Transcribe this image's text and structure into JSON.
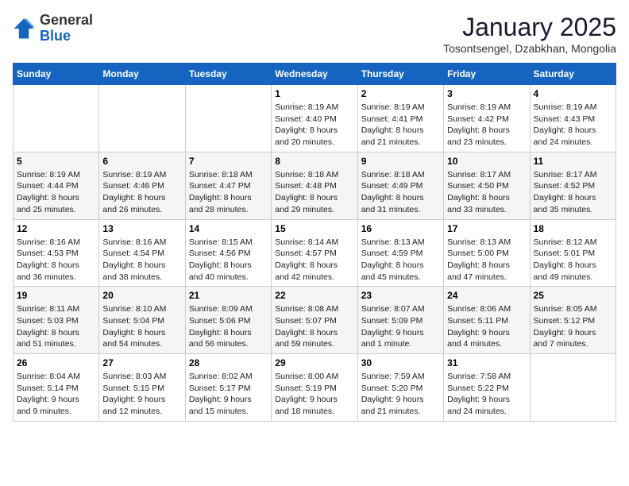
{
  "logo": {
    "general": "General",
    "blue": "Blue"
  },
  "title": "January 2025",
  "subtitle": "Tosontsengel, Dzabkhan, Mongolia",
  "days_of_week": [
    "Sunday",
    "Monday",
    "Tuesday",
    "Wednesday",
    "Thursday",
    "Friday",
    "Saturday"
  ],
  "weeks": [
    [
      {
        "day": "",
        "info": ""
      },
      {
        "day": "",
        "info": ""
      },
      {
        "day": "",
        "info": ""
      },
      {
        "day": "1",
        "info": "Sunrise: 8:19 AM\nSunset: 4:40 PM\nDaylight: 8 hours\nand 20 minutes."
      },
      {
        "day": "2",
        "info": "Sunrise: 8:19 AM\nSunset: 4:41 PM\nDaylight: 8 hours\nand 21 minutes."
      },
      {
        "day": "3",
        "info": "Sunrise: 8:19 AM\nSunset: 4:42 PM\nDaylight: 8 hours\nand 23 minutes."
      },
      {
        "day": "4",
        "info": "Sunrise: 8:19 AM\nSunset: 4:43 PM\nDaylight: 8 hours\nand 24 minutes."
      }
    ],
    [
      {
        "day": "5",
        "info": "Sunrise: 8:19 AM\nSunset: 4:44 PM\nDaylight: 8 hours\nand 25 minutes."
      },
      {
        "day": "6",
        "info": "Sunrise: 8:19 AM\nSunset: 4:46 PM\nDaylight: 8 hours\nand 26 minutes."
      },
      {
        "day": "7",
        "info": "Sunrise: 8:18 AM\nSunset: 4:47 PM\nDaylight: 8 hours\nand 28 minutes."
      },
      {
        "day": "8",
        "info": "Sunrise: 8:18 AM\nSunset: 4:48 PM\nDaylight: 8 hours\nand 29 minutes."
      },
      {
        "day": "9",
        "info": "Sunrise: 8:18 AM\nSunset: 4:49 PM\nDaylight: 8 hours\nand 31 minutes."
      },
      {
        "day": "10",
        "info": "Sunrise: 8:17 AM\nSunset: 4:50 PM\nDaylight: 8 hours\nand 33 minutes."
      },
      {
        "day": "11",
        "info": "Sunrise: 8:17 AM\nSunset: 4:52 PM\nDaylight: 8 hours\nand 35 minutes."
      }
    ],
    [
      {
        "day": "12",
        "info": "Sunrise: 8:16 AM\nSunset: 4:53 PM\nDaylight: 8 hours\nand 36 minutes."
      },
      {
        "day": "13",
        "info": "Sunrise: 8:16 AM\nSunset: 4:54 PM\nDaylight: 8 hours\nand 38 minutes."
      },
      {
        "day": "14",
        "info": "Sunrise: 8:15 AM\nSunset: 4:56 PM\nDaylight: 8 hours\nand 40 minutes."
      },
      {
        "day": "15",
        "info": "Sunrise: 8:14 AM\nSunset: 4:57 PM\nDaylight: 8 hours\nand 42 minutes."
      },
      {
        "day": "16",
        "info": "Sunrise: 8:13 AM\nSunset: 4:59 PM\nDaylight: 8 hours\nand 45 minutes."
      },
      {
        "day": "17",
        "info": "Sunrise: 8:13 AM\nSunset: 5:00 PM\nDaylight: 8 hours\nand 47 minutes."
      },
      {
        "day": "18",
        "info": "Sunrise: 8:12 AM\nSunset: 5:01 PM\nDaylight: 8 hours\nand 49 minutes."
      }
    ],
    [
      {
        "day": "19",
        "info": "Sunrise: 8:11 AM\nSunset: 5:03 PM\nDaylight: 8 hours\nand 51 minutes."
      },
      {
        "day": "20",
        "info": "Sunrise: 8:10 AM\nSunset: 5:04 PM\nDaylight: 8 hours\nand 54 minutes."
      },
      {
        "day": "21",
        "info": "Sunrise: 8:09 AM\nSunset: 5:06 PM\nDaylight: 8 hours\nand 56 minutes."
      },
      {
        "day": "22",
        "info": "Sunrise: 8:08 AM\nSunset: 5:07 PM\nDaylight: 8 hours\nand 59 minutes."
      },
      {
        "day": "23",
        "info": "Sunrise: 8:07 AM\nSunset: 5:09 PM\nDaylight: 9 hours\nand 1 minute."
      },
      {
        "day": "24",
        "info": "Sunrise: 8:06 AM\nSunset: 5:11 PM\nDaylight: 9 hours\nand 4 minutes."
      },
      {
        "day": "25",
        "info": "Sunrise: 8:05 AM\nSunset: 5:12 PM\nDaylight: 9 hours\nand 7 minutes."
      }
    ],
    [
      {
        "day": "26",
        "info": "Sunrise: 8:04 AM\nSunset: 5:14 PM\nDaylight: 9 hours\nand 9 minutes."
      },
      {
        "day": "27",
        "info": "Sunrise: 8:03 AM\nSunset: 5:15 PM\nDaylight: 9 hours\nand 12 minutes."
      },
      {
        "day": "28",
        "info": "Sunrise: 8:02 AM\nSunset: 5:17 PM\nDaylight: 9 hours\nand 15 minutes."
      },
      {
        "day": "29",
        "info": "Sunrise: 8:00 AM\nSunset: 5:19 PM\nDaylight: 9 hours\nand 18 minutes."
      },
      {
        "day": "30",
        "info": "Sunrise: 7:59 AM\nSunset: 5:20 PM\nDaylight: 9 hours\nand 21 minutes."
      },
      {
        "day": "31",
        "info": "Sunrise: 7:58 AM\nSunset: 5:22 PM\nDaylight: 9 hours\nand 24 minutes."
      },
      {
        "day": "",
        "info": ""
      }
    ]
  ]
}
